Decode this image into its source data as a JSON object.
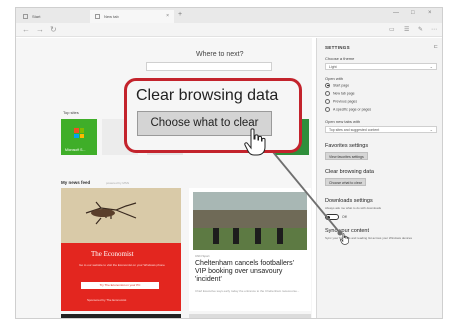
{
  "browser": {
    "tabs": [
      {
        "label": "Start"
      },
      {
        "label": "New tab"
      }
    ],
    "new_tab_symbol": "+",
    "window_controls": [
      "—",
      "□",
      "×"
    ]
  },
  "main": {
    "heading": "Where to next?",
    "top_sites_label": "Top sites",
    "top_sites": [
      {
        "name": "Microsoft S..."
      }
    ],
    "news_feed_label": "My news feed",
    "news_feed_sub": "powered by MSN",
    "economist_card": {
      "title": "The Economist",
      "text": "Go to our website to visit the Economist on your Windows phone",
      "button": "Try The Economist on your PC",
      "footer": "Sponsored by The Economist"
    },
    "news_card": {
      "source": "CNN Sport",
      "headline": "Cheltenham cancels footballers' VIP booking over unsavoury 'incident'",
      "body": "Chief Executive says early today the entrance to the Cheltenham racecourse..."
    }
  },
  "settings": {
    "title": "SETTINGS",
    "choose_theme_label": "Choose a theme",
    "theme_value": "Light",
    "open_with_label": "Open with",
    "open_with_options": [
      {
        "label": "Start page",
        "selected": true
      },
      {
        "label": "New tab page",
        "selected": false
      },
      {
        "label": "Previous pages",
        "selected": false
      },
      {
        "label": "A specific page or pages",
        "selected": false
      }
    ],
    "new_tabs_label": "Open new tabs with",
    "new_tabs_value": "Top sites and suggested content",
    "favorites_heading": "Favorites settings",
    "favorites_button": "View favorites settings",
    "clear_heading": "Clear browsing data",
    "clear_button": "Choose what to clear",
    "downloads_heading": "Downloads settings",
    "downloads_sub": "Always ask me what to do with downloads",
    "downloads_toggle": "Off",
    "sync_heading": "Sync your content",
    "sync_sub": "Sync your favorites and reading list across your Windows devices"
  },
  "callout": {
    "title": "Clear browsing data",
    "button": "Choose what to clear"
  },
  "colors": {
    "callout_border": "#c3232c",
    "economist_red": "#e3261f",
    "tile_green": "#3fae29"
  }
}
